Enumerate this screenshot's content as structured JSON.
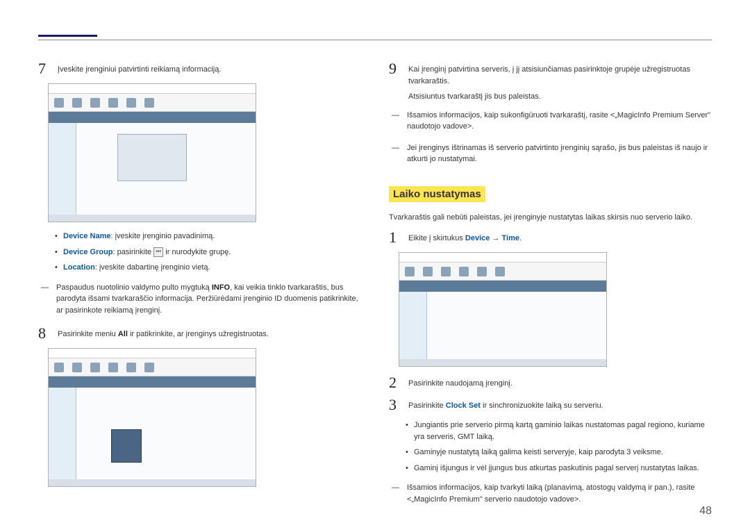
{
  "page_number": "48",
  "left": {
    "step7": {
      "num": "7",
      "text": "Įveskite įrenginiui patvirtinti reikiamą informaciją.",
      "bullets": [
        {
          "label": "Device Name",
          "rest": ": įveskite įrenginio pavadinimą."
        },
        {
          "label": "Device Group",
          "rest_pre": ": pasirinkite ",
          "rest_post": " ir nurodykite grupę."
        },
        {
          "label": "Location",
          "rest": ": įveskite dabartinę įrenginio vietą."
        }
      ],
      "note_pre": "Paspaudus nuotolinio valdymo pulto mygtuką ",
      "note_bold": "INFO",
      "note_post": ", kai veikia tinklo tvarkaraštis, bus parodyta išsami tvarkaraščio informacija. Peržiūrėdami įrenginio ID duomenis patikrinkite, ar pasirinkote reikiamą įrenginį."
    },
    "step8": {
      "num": "8",
      "text_pre": "Pasirinkite meniu ",
      "text_bold": "All",
      "text_post": " ir patikrinkite, ar įrenginys užregistruotas."
    }
  },
  "right": {
    "step9": {
      "num": "9",
      "line1": "Kai įrenginį patvirtina serveris, į jį atsisiunčiamas pasirinktoje grupėje užregistruotas tvarkaraštis.",
      "line2": "Atsisiuntus tvarkaraštį jis bus paleistas.",
      "note1": "Išsamios informacijos, kaip sukonfigūruoti tvarkaraštį, rasite <„MagicInfo Premium Server\" naudotojo vadove>.",
      "note2": "Jei įrenginys ištrinamas iš serverio patvirtinto įrenginių sąrašo, jis bus paleistas iš naujo ir atkurti jo nustatymai."
    },
    "heading": "Laiko nustatymas",
    "intro": "Tvarkaraštis gali nebūti paleistas, jei įrenginyje nustatytas laikas skirsis nuo serverio laiko.",
    "step1": {
      "num": "1",
      "pre": "Eikite į skirtukus ",
      "t1": "Device",
      "arrow": " → ",
      "t2": "Time",
      "post": "."
    },
    "step2": {
      "num": "2",
      "text": "Pasirinkite naudojamą įrenginį."
    },
    "step3": {
      "num": "3",
      "pre": "Pasirinkite ",
      "bold": "Clock Set",
      "post": " ir sinchronizuokite laiką su serveriu.",
      "bullets": [
        "Jungiantis prie serverio pirmą kartą gaminio laikas nustatomas pagal regiono, kuriame yra serveris, GMT laiką.",
        "Gaminyje nustatytą laiką galima keisti serveryje, kaip parodyta 3 veiksme.",
        "Gaminį išjungus ir vėl įjungus bus atkurtas paskutinis pagal serverį nustatytas laikas."
      ],
      "note": "Išsamios informacijos, kaip tvarkyti laiką (planavimą, atostogų valdymą ir pan.), rasite <„MagicInfo Premium\" serverio naudotojo vadove>."
    }
  }
}
